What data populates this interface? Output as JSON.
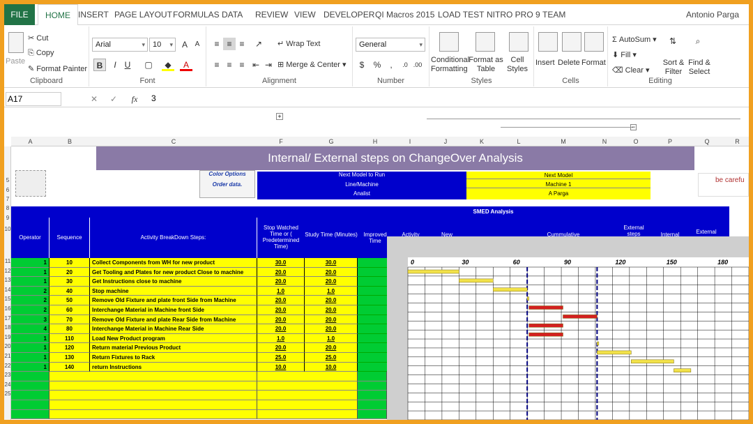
{
  "ribbon_tabs": [
    "FILE",
    "HOME",
    "INSERT",
    "PAGE LAYOUT",
    "FORMULAS",
    "DATA",
    "REVIEW",
    "VIEW",
    "DEVELOPER",
    "QI Macros 2015",
    "LOAD TEST",
    "NITRO PRO 9",
    "TEAM"
  ],
  "user": "Antonio Parga",
  "clipboard": {
    "paste": "Paste",
    "cut": "Cut",
    "copy": "Copy",
    "format_painter": "Format Painter",
    "label": "Clipboard"
  },
  "font": {
    "name": "Arial",
    "size": "10",
    "label": "Font",
    "bold": "B",
    "italic": "I",
    "underline": "U"
  },
  "alignment": {
    "wrap": "Wrap Text",
    "merge": "Merge & Center",
    "label": "Alignment"
  },
  "number": {
    "format": "General",
    "label": "Number",
    "currency": "$",
    "percent": "%"
  },
  "styles": {
    "conditional": "Conditional Formatting",
    "format_table": "Format as Table",
    "cell_styles": "Cell Styles",
    "label": "Styles"
  },
  "cells": {
    "insert": "Insert",
    "delete": "Delete",
    "format": "Format",
    "label": "Cells"
  },
  "editing": {
    "autosum": "AutoSum",
    "fill": "Fill",
    "clear": "Clear",
    "sort": "Sort & Filter",
    "find": "Find & Select",
    "label": "Editing"
  },
  "formula_bar": {
    "name_box": "A17",
    "value": "3",
    "fx": "fx"
  },
  "columns": [
    "A",
    "B",
    "C",
    "F",
    "G",
    "H",
    "I",
    "J",
    "K",
    "L",
    "M",
    "N",
    "O",
    "P",
    "Q",
    "R"
  ],
  "rows": [
    "5",
    "6",
    "7",
    "8",
    "9",
    "10",
    "11",
    "12",
    "13",
    "14",
    "15",
    "16",
    "17",
    "18",
    "19",
    "20",
    "21",
    "22",
    "23",
    "24",
    "25"
  ],
  "sheet": {
    "title": "Internal/ External steps on ChangeOver Analysis",
    "side_links": [
      "Color Options",
      "Order data."
    ],
    "be_careful": "be carefu",
    "info": [
      {
        "label": "Next Model to Run",
        "value": "Next Model"
      },
      {
        "label": "Line/Machine",
        "value": "Machine 1"
      },
      {
        "label": "Analist",
        "value": "A Parga"
      }
    ],
    "smed": "SMED Analysis",
    "headers": {
      "operator": "Operator",
      "sequence": "Sequence",
      "activity": "Activity BreakDown Steps:",
      "watched": "Stop Watched Time or ( Predetermined Time)",
      "study": "Study Time (Minutes)",
      "improved": "Improved Time",
      "activity2": "Activity",
      "new": "New",
      "cumm": "Cummulative",
      "ext": "External steps",
      "internal": "Internal",
      "external": "External"
    },
    "rows": [
      {
        "op": "1",
        "seq": "10",
        "step": "Collect Components from WH for new product",
        "w": "30.0",
        "s": "30.0"
      },
      {
        "op": "1",
        "seq": "20",
        "step": "Get Tooling and Plates for new product Close to machine",
        "w": "20.0",
        "s": "20.0"
      },
      {
        "op": "1",
        "seq": "30",
        "step": "Get Instructions close to machine",
        "w": "20.0",
        "s": "20.0"
      },
      {
        "op": "2",
        "seq": "40",
        "step": "Stop machine",
        "w": "1.0",
        "s": "1.0"
      },
      {
        "op": "2",
        "seq": "50",
        "step": "Remove Old Fixture and plate front Side from Machine",
        "w": "20.0",
        "s": "20.0"
      },
      {
        "op": "2",
        "seq": "60",
        "step": "Interchange Material in Machine front Side",
        "w": "20.0",
        "s": "20.0"
      },
      {
        "op": "3",
        "seq": "70",
        "step": "Remove Old Fixture and plate Rear Side from Machine",
        "w": "20.0",
        "s": "20.0"
      },
      {
        "op": "4",
        "seq": "80",
        "step": "Interchange Material in Machine Rear Side",
        "w": "20.0",
        "s": "20.0"
      },
      {
        "op": "1",
        "seq": "110",
        "step": "Load New Product program",
        "w": "1.0",
        "s": "1.0"
      },
      {
        "op": "1",
        "seq": "120",
        "step": "Return material Previous Product",
        "w": "20.0",
        "s": "20.0"
      },
      {
        "op": "1",
        "seq": "130",
        "step": "Return Fixtures to Rack",
        "w": "25.0",
        "s": "25.0"
      },
      {
        "op": "1",
        "seq": "140",
        "step": "return  Instructions",
        "w": "10.0",
        "s": "10.0"
      }
    ]
  },
  "chart_data": {
    "type": "bar",
    "x_ticks": [
      "0",
      "30",
      "60",
      "90",
      "120",
      "150",
      "180"
    ],
    "xlim": [
      0,
      200
    ],
    "bars": [
      {
        "start": 0,
        "dur": 30,
        "color": "#f2e24a"
      },
      {
        "start": 30,
        "dur": 20,
        "color": "#f2e24a"
      },
      {
        "start": 50,
        "dur": 20,
        "color": "#f2e24a"
      },
      {
        "start": 70,
        "dur": 1,
        "color": "#f2e24a"
      },
      {
        "start": 71,
        "dur": 20,
        "color": "#d42020"
      },
      {
        "start": 91,
        "dur": 20,
        "color": "#d42020"
      },
      {
        "start": 71,
        "dur": 20,
        "color": "#d42020"
      },
      {
        "start": 71,
        "dur": 20,
        "color": "#d42020"
      },
      {
        "start": 111,
        "dur": 1,
        "color": "#f2e24a"
      },
      {
        "start": 111,
        "dur": 20,
        "color": "#f2e24a"
      },
      {
        "start": 131,
        "dur": 25,
        "color": "#f2e24a"
      },
      {
        "start": 156,
        "dur": 10,
        "color": "#f2e24a"
      }
    ],
    "markers": [
      70,
      111
    ]
  }
}
